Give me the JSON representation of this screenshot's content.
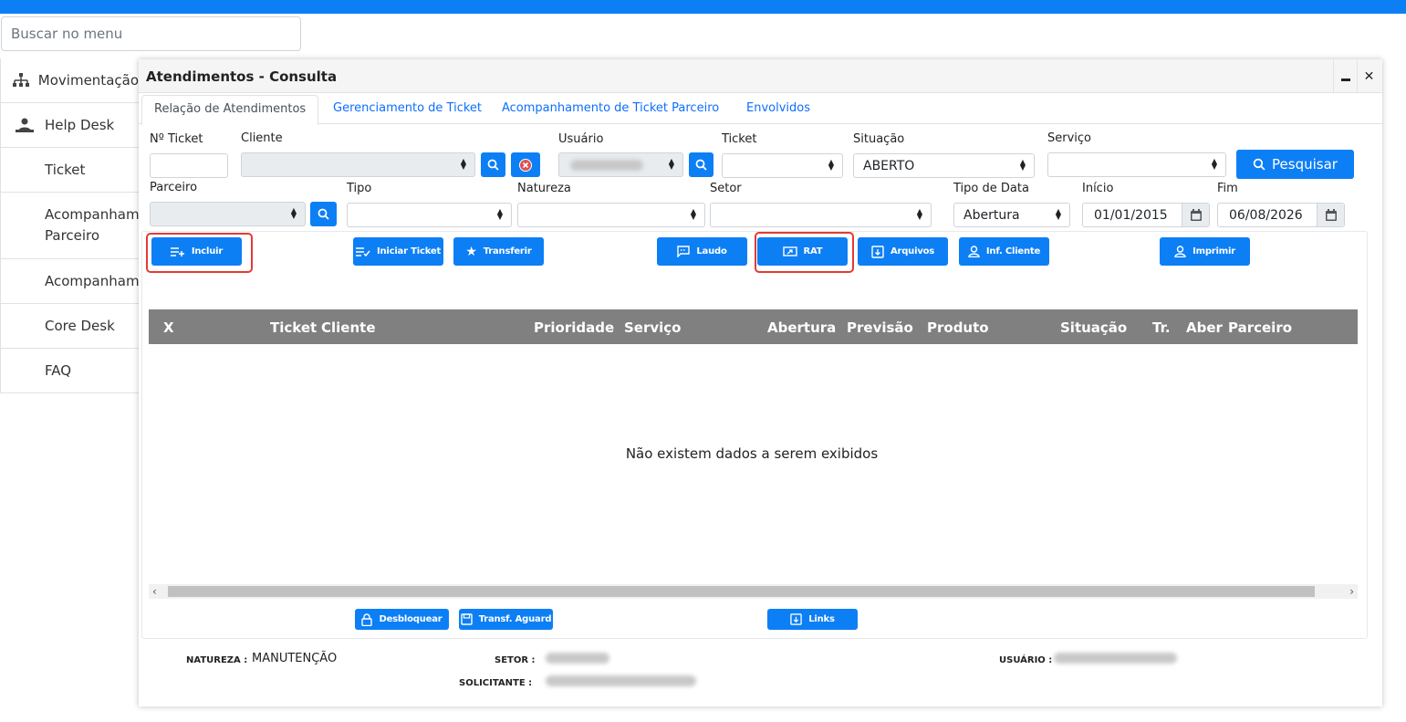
{
  "menu": {
    "search_placeholder": "Buscar no menu",
    "items": [
      {
        "label": "Movimentação",
        "icon": "sitemap-icon"
      },
      {
        "label": "Help Desk",
        "icon": "support-agent-icon"
      },
      {
        "label": "Ticket"
      },
      {
        "label": "Acompanhamento Parceiro"
      },
      {
        "label": "Acompanhamento"
      },
      {
        "label": "Core Desk"
      },
      {
        "label": "FAQ"
      }
    ]
  },
  "window": {
    "title": "Atendimentos - Consulta",
    "minimize": "‗",
    "close": "✕"
  },
  "tabs": [
    {
      "label": "Relação de Atendimentos",
      "active": true
    },
    {
      "label": "Gerenciamento de Ticket"
    },
    {
      "label": "Acompanhamento de Ticket Parceiro"
    },
    {
      "label": "Envolvidos"
    }
  ],
  "filters": {
    "ticket_no_label": "Nº Ticket",
    "cliente_label": "Cliente",
    "usuario_label": "Usuário",
    "ticket_label": "Ticket",
    "situacao_label": "Situação",
    "situacao_value": "ABERTO",
    "servico_label": "Serviço",
    "parceiro_label": "Parceiro",
    "tipo_label": "Tipo",
    "natureza_label": "Natureza",
    "setor_label": "Setor",
    "tipo_data_label": "Tipo de Data",
    "tipo_data_value": "Abertura",
    "inicio_label": "Início",
    "inicio_value": "01/01/2015",
    "fim_label": "Fim",
    "fim_value": "06/08/2026",
    "pesquisar_label": "Pesquisar"
  },
  "actions": {
    "incluir": "Incluir",
    "iniciar_ticket": "Iniciar Ticket",
    "transferir": "Transferir",
    "laudo": "Laudo",
    "rat": "RAT",
    "arquivos": "Arquivos",
    "inf_cliente": "Inf. Cliente",
    "imprimir": "Imprimir"
  },
  "grid": {
    "columns": [
      "X",
      "Ticket",
      "Cliente",
      "Prioridade",
      "Serviço",
      "Abertura",
      "Previsão",
      "Produto",
      "Situação",
      "Tr.",
      "Aber",
      "Parceiro"
    ],
    "empty_message": "Não existem dados a serem exibidos"
  },
  "bottom_actions": {
    "desbloquear": "Desbloquear",
    "transf_aguard": "Transf. Aguard",
    "links": "Links"
  },
  "info": {
    "natureza_label": "NATUREZA :",
    "natureza_value": "MANUTENÇÃO",
    "setor_label": "SETOR :",
    "solicitante_label": "SOLICITANTE :",
    "usuario_label": "USUÁRIO :"
  },
  "colors": {
    "primary": "#0d7ff5",
    "grid_header": "#808080",
    "highlight": "#e53935"
  }
}
